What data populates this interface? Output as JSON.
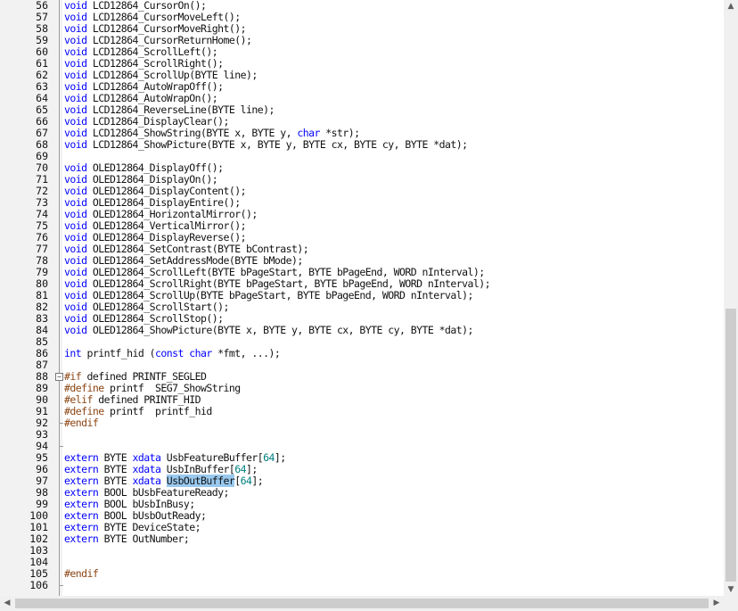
{
  "editor": {
    "current_line": 97,
    "lines": [
      {
        "n": "56",
        "tokens": [
          {
            "t": "void",
            "c": "kw"
          },
          {
            "t": " LCD12864_CursorOn();"
          }
        ]
      },
      {
        "n": "57",
        "tokens": [
          {
            "t": "void",
            "c": "kw"
          },
          {
            "t": " LCD12864_CursorMoveLeft();"
          }
        ]
      },
      {
        "n": "58",
        "tokens": [
          {
            "t": "void",
            "c": "kw"
          },
          {
            "t": " LCD12864_CursorMoveRight();"
          }
        ]
      },
      {
        "n": "59",
        "tokens": [
          {
            "t": "void",
            "c": "kw"
          },
          {
            "t": " LCD12864_CursorReturnHome();"
          }
        ]
      },
      {
        "n": "60",
        "tokens": [
          {
            "t": "void",
            "c": "kw"
          },
          {
            "t": " LCD12864_ScrollLeft();"
          }
        ]
      },
      {
        "n": "61",
        "tokens": [
          {
            "t": "void",
            "c": "kw"
          },
          {
            "t": " LCD12864_ScrollRight();"
          }
        ]
      },
      {
        "n": "62",
        "tokens": [
          {
            "t": "void",
            "c": "kw"
          },
          {
            "t": " LCD12864_ScrollUp(BYTE line);"
          }
        ]
      },
      {
        "n": "63",
        "tokens": [
          {
            "t": "void",
            "c": "kw"
          },
          {
            "t": " LCD12864_AutoWrapOff();"
          }
        ]
      },
      {
        "n": "64",
        "tokens": [
          {
            "t": "void",
            "c": "kw"
          },
          {
            "t": " LCD12864_AutoWrapOn();"
          }
        ]
      },
      {
        "n": "65",
        "tokens": [
          {
            "t": "void",
            "c": "kw"
          },
          {
            "t": " LCD12864_ReverseLine(BYTE line);"
          }
        ]
      },
      {
        "n": "66",
        "tokens": [
          {
            "t": "void",
            "c": "kw"
          },
          {
            "t": " LCD12864_DisplayClear();"
          }
        ]
      },
      {
        "n": "67",
        "tokens": [
          {
            "t": "void",
            "c": "kw"
          },
          {
            "t": " LCD12864_ShowString(BYTE x, BYTE y, "
          },
          {
            "t": "char",
            "c": "kw"
          },
          {
            "t": " *str);"
          }
        ]
      },
      {
        "n": "68",
        "tokens": [
          {
            "t": "void",
            "c": "kw"
          },
          {
            "t": " LCD12864_ShowPicture(BYTE x, BYTE y, BYTE cx, BYTE cy, BYTE *dat);"
          }
        ]
      },
      {
        "n": "69",
        "tokens": []
      },
      {
        "n": "70",
        "tokens": [
          {
            "t": "void",
            "c": "kw"
          },
          {
            "t": " OLED12864_DisplayOff();"
          }
        ]
      },
      {
        "n": "71",
        "tokens": [
          {
            "t": "void",
            "c": "kw"
          },
          {
            "t": " OLED12864_DisplayOn();"
          }
        ]
      },
      {
        "n": "72",
        "tokens": [
          {
            "t": "void",
            "c": "kw"
          },
          {
            "t": " OLED12864_DisplayContent();"
          }
        ]
      },
      {
        "n": "73",
        "tokens": [
          {
            "t": "void",
            "c": "kw"
          },
          {
            "t": " OLED12864_DisplayEntire();"
          }
        ]
      },
      {
        "n": "74",
        "tokens": [
          {
            "t": "void",
            "c": "kw"
          },
          {
            "t": " OLED12864_HorizontalMirror();"
          }
        ]
      },
      {
        "n": "75",
        "tokens": [
          {
            "t": "void",
            "c": "kw"
          },
          {
            "t": " OLED12864_VerticalMirror();"
          }
        ]
      },
      {
        "n": "76",
        "tokens": [
          {
            "t": "void",
            "c": "kw"
          },
          {
            "t": " OLED12864_DisplayReverse();"
          }
        ]
      },
      {
        "n": "77",
        "tokens": [
          {
            "t": "void",
            "c": "kw"
          },
          {
            "t": " OLED12864_SetContrast(BYTE bContrast);"
          }
        ]
      },
      {
        "n": "78",
        "tokens": [
          {
            "t": "void",
            "c": "kw"
          },
          {
            "t": " OLED12864_SetAddressMode(BYTE bMode);"
          }
        ]
      },
      {
        "n": "79",
        "tokens": [
          {
            "t": "void",
            "c": "kw"
          },
          {
            "t": " OLED12864_ScrollLeft(BYTE bPageStart, BYTE bPageEnd, WORD nInterval);"
          }
        ]
      },
      {
        "n": "80",
        "tokens": [
          {
            "t": "void",
            "c": "kw"
          },
          {
            "t": " OLED12864_ScrollRight(BYTE bPageStart, BYTE bPageEnd, WORD nInterval);"
          }
        ]
      },
      {
        "n": "81",
        "tokens": [
          {
            "t": "void",
            "c": "kw"
          },
          {
            "t": " OLED12864_ScrollUp(BYTE bPageStart, BYTE bPageEnd, WORD nInterval);"
          }
        ]
      },
      {
        "n": "82",
        "tokens": [
          {
            "t": "void",
            "c": "kw"
          },
          {
            "t": " OLED12864_ScrollStart();"
          }
        ]
      },
      {
        "n": "83",
        "tokens": [
          {
            "t": "void",
            "c": "kw"
          },
          {
            "t": " OLED12864_ScrollStop();"
          }
        ]
      },
      {
        "n": "84",
        "tokens": [
          {
            "t": "void",
            "c": "kw"
          },
          {
            "t": " OLED12864_ShowPicture(BYTE x, BYTE y, BYTE cx, BYTE cy, BYTE *dat);"
          }
        ]
      },
      {
        "n": "85",
        "tokens": []
      },
      {
        "n": "86",
        "tokens": [
          {
            "t": "int",
            "c": "kw"
          },
          {
            "t": " printf_hid ("
          },
          {
            "t": "const",
            "c": "kw"
          },
          {
            "t": " "
          },
          {
            "t": "char",
            "c": "kw"
          },
          {
            "t": " *fmt, ...);"
          }
        ]
      },
      {
        "n": "87",
        "tokens": []
      },
      {
        "n": "88",
        "fold": "open",
        "tokens": [
          {
            "t": "#if",
            "c": "pp"
          },
          {
            "t": " defined PRINTF_SEGLED"
          }
        ]
      },
      {
        "n": "89",
        "tokens": [
          {
            "t": "#define",
            "c": "pp"
          },
          {
            "t": " printf  SEG7_ShowString"
          }
        ]
      },
      {
        "n": "90",
        "tokens": [
          {
            "t": "#elif",
            "c": "pp"
          },
          {
            "t": " defined PRINTF_HID"
          }
        ]
      },
      {
        "n": "91",
        "tokens": [
          {
            "t": "#define",
            "c": "pp"
          },
          {
            "t": " printf  printf_hid"
          }
        ]
      },
      {
        "n": "92",
        "fold": "end",
        "tokens": [
          {
            "t": "#endif",
            "c": "pp"
          }
        ]
      },
      {
        "n": "93",
        "tokens": []
      },
      {
        "n": "94",
        "fold": "end",
        "tokens": []
      },
      {
        "n": "95",
        "tokens": [
          {
            "t": "extern",
            "c": "kw"
          },
          {
            "t": " BYTE "
          },
          {
            "t": "xdata",
            "c": "kw"
          },
          {
            "t": " UsbFeatureBuffer["
          },
          {
            "t": "64",
            "c": "num"
          },
          {
            "t": "];"
          }
        ]
      },
      {
        "n": "96",
        "tokens": [
          {
            "t": "extern",
            "c": "kw"
          },
          {
            "t": " BYTE "
          },
          {
            "t": "xdata",
            "c": "kw"
          },
          {
            "t": " UsbInBuffer["
          },
          {
            "t": "64",
            "c": "num"
          },
          {
            "t": "];"
          }
        ]
      },
      {
        "n": "97",
        "tokens": [
          {
            "t": "extern",
            "c": "kw"
          },
          {
            "t": " BYTE "
          },
          {
            "t": "xdata",
            "c": "kw"
          },
          {
            "t": " "
          },
          {
            "t": "UsbOutBuffer",
            "c": "sel"
          },
          {
            "t": "["
          },
          {
            "t": "64",
            "c": "num"
          },
          {
            "t": "];"
          }
        ]
      },
      {
        "n": "98",
        "tokens": [
          {
            "t": "extern",
            "c": "kw"
          },
          {
            "t": " BOOL bUsbFeatureReady;"
          }
        ]
      },
      {
        "n": "99",
        "tokens": [
          {
            "t": "extern",
            "c": "kw"
          },
          {
            "t": " BOOL bUsbInBusy;"
          }
        ]
      },
      {
        "n": "100",
        "tokens": [
          {
            "t": "extern",
            "c": "kw"
          },
          {
            "t": " BOOL bUsbOutReady;"
          }
        ]
      },
      {
        "n": "101",
        "tokens": [
          {
            "t": "extern",
            "c": "kw"
          },
          {
            "t": " BYTE DeviceState;"
          }
        ]
      },
      {
        "n": "102",
        "tokens": [
          {
            "t": "extern",
            "c": "kw"
          },
          {
            "t": " BYTE OutNumber;"
          }
        ]
      },
      {
        "n": "103",
        "tokens": []
      },
      {
        "n": "104",
        "tokens": []
      },
      {
        "n": "105",
        "tokens": [
          {
            "t": "#endif",
            "c": "pp"
          }
        ]
      },
      {
        "n": "106",
        "fold": "end",
        "tokens": []
      }
    ]
  },
  "scrollbars": {
    "up_icon": "▲",
    "down_icon": "▼",
    "left_icon": "◀",
    "right_icon": "▶"
  },
  "colors": {
    "keyword": "#0000ff",
    "preprocessor": "#8b4513",
    "number": "#008080",
    "current_line_bg": "#e8fbe9",
    "selection_bg": "#99c9ef"
  }
}
